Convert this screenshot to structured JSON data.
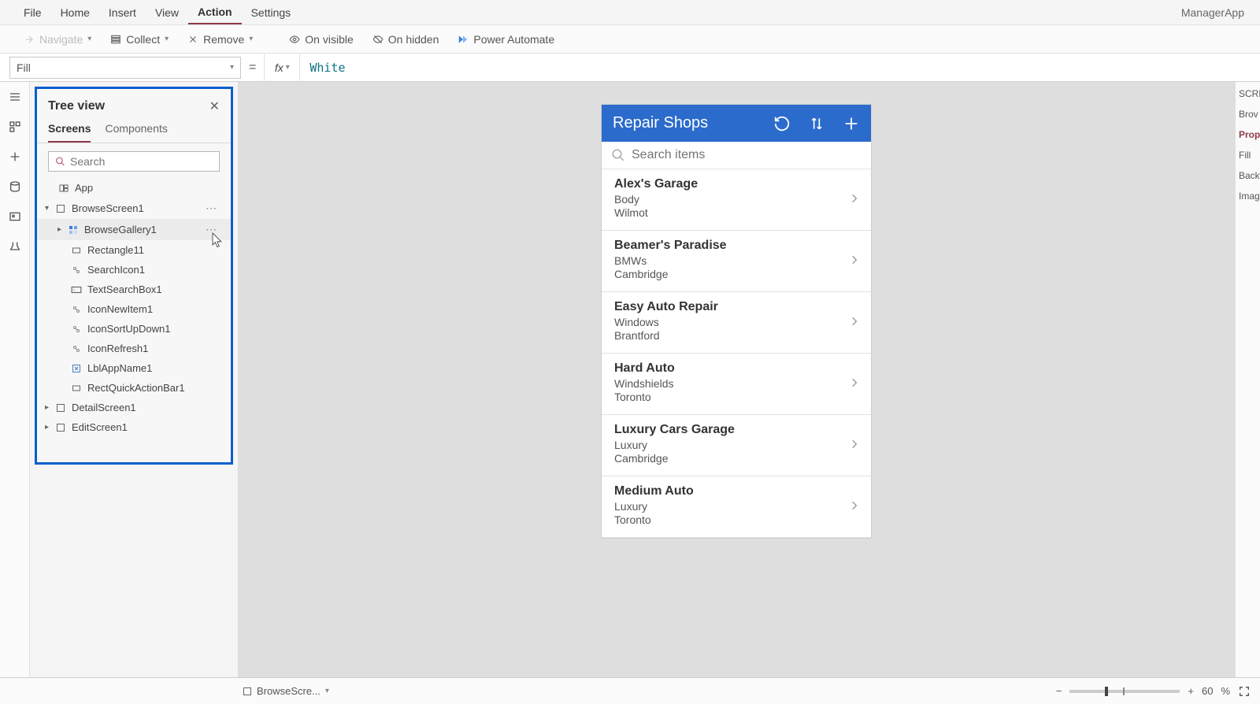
{
  "app_name": "ManagerApp",
  "menu": [
    "File",
    "Home",
    "Insert",
    "View",
    "Action",
    "Settings"
  ],
  "menu_active": "Action",
  "ribbon": {
    "navigate": "Navigate",
    "collect": "Collect",
    "remove": "Remove",
    "on_visible": "On visible",
    "on_hidden": "On hidden",
    "power_automate": "Power Automate"
  },
  "formula_bar": {
    "property": "Fill",
    "fx": "fx",
    "value": "White"
  },
  "tree": {
    "title": "Tree view",
    "tabs": [
      "Screens",
      "Components"
    ],
    "active_tab": "Screens",
    "search_placeholder": "Search",
    "nodes": {
      "app": "App",
      "browse_screen": "BrowseScreen1",
      "browse_gallery": "BrowseGallery1",
      "rectangle": "Rectangle11",
      "search_icon": "SearchIcon1",
      "text_search": "TextSearchBox1",
      "icon_new": "IconNewItem1",
      "icon_sort": "IconSortUpDown1",
      "icon_refresh": "IconRefresh1",
      "lbl_app": "LblAppName1",
      "rect_quick": "RectQuickActionBar1",
      "detail_screen": "DetailScreen1",
      "edit_screen": "EditScreen1"
    }
  },
  "phone": {
    "title": "Repair Shops",
    "search_placeholder": "Search items",
    "items": [
      {
        "title": "Alex's Garage",
        "sub": "Body",
        "city": "Wilmot"
      },
      {
        "title": "Beamer's Paradise",
        "sub": "BMWs",
        "city": "Cambridge"
      },
      {
        "title": "Easy Auto Repair",
        "sub": "Windows",
        "city": "Brantford"
      },
      {
        "title": "Hard Auto",
        "sub": "Windshields",
        "city": "Toronto"
      },
      {
        "title": "Luxury Cars Garage",
        "sub": "Luxury",
        "city": "Cambridge"
      },
      {
        "title": "Medium Auto",
        "sub": "Luxury",
        "city": "Toronto"
      }
    ]
  },
  "right_panel": {
    "scre": "SCRE",
    "brov": "Brov",
    "prop": "Prop",
    "fill": "Fill",
    "back": "Back",
    "imag": "Imag"
  },
  "status": {
    "screen_label": "BrowseScre...",
    "zoom_minus": "−",
    "zoom_plus": "+",
    "zoom_value": "60",
    "zoom_pct": "%"
  }
}
